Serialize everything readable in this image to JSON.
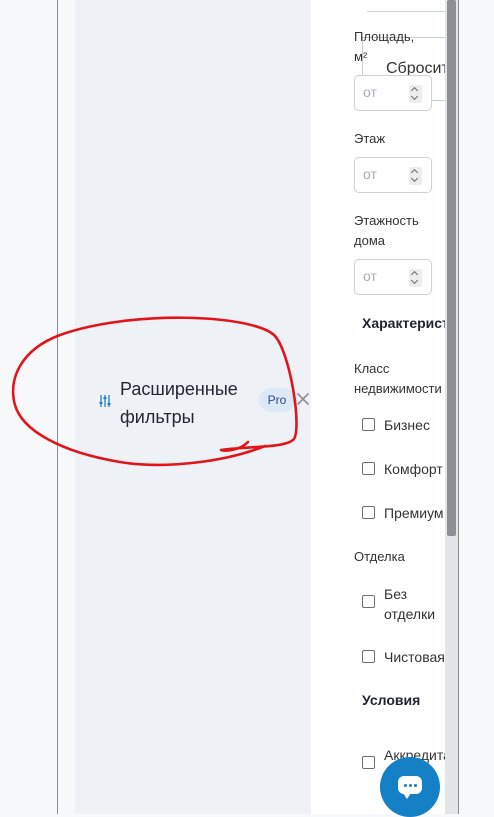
{
  "advanced_filters": {
    "title_line1": "Расширенные",
    "title_line2": "фильтры",
    "badge": "Pro",
    "icon": "sliders-icon",
    "close_icon": "close-icon"
  },
  "filters": {
    "reset_label": "Сбросить",
    "area": {
      "label_line1": "Площадь,",
      "label_line2": "м²",
      "placeholder": "от"
    },
    "floor": {
      "label": "Этаж",
      "placeholder": "от"
    },
    "floors_total": {
      "label_line1": "Этажность",
      "label_line2": "дома",
      "placeholder": "от"
    },
    "characteristics_title": "Характеристики",
    "property_class": {
      "label_line1": "Класс",
      "label_line2": "недвижимости",
      "options": [
        "Бизнес",
        "Комфорт",
        "Премиум"
      ]
    },
    "finishing": {
      "label": "Отделка",
      "options": [
        {
          "line1": "Без",
          "line2": "отделки"
        },
        {
          "line1": "Чистовая",
          "line2": ""
        }
      ]
    },
    "conditions_title": "Условия",
    "conditions_options": [
      "Аккредитация"
    ]
  },
  "chat": {
    "icon": "chat-icon"
  },
  "colors": {
    "accent": "#1580c6",
    "annotation": "#e0141a",
    "badge_bg": "#dde8f7"
  }
}
